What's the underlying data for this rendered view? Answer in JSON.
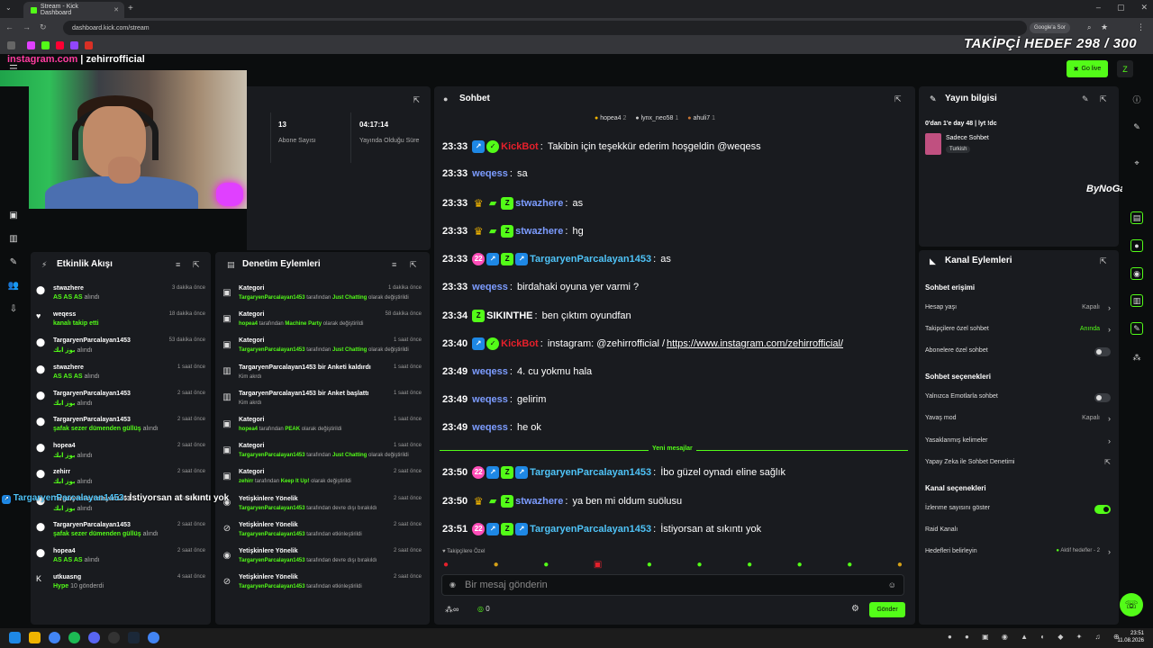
{
  "browser": {
    "tab_title": "Stream - Kick Dashboard",
    "url": "dashboard.kick.com/stream",
    "google_btn": "Google'a Sor"
  },
  "overlay": {
    "follower_goal": "TAKİPÇİ HEDEF 298 / 300",
    "instagram_site": "instagram.com",
    "instagram_user": "zehirrofficial",
    "bynogame": "ByNoGame"
  },
  "header": {
    "go_live": "Go live"
  },
  "stats": {
    "subscribers_value": "13",
    "subscribers_label": "Abone Sayısı",
    "duration_value": "04:17:14",
    "duration_label": "Yayında Olduğu Süre"
  },
  "activity": {
    "title": "Etkinlik Akışı",
    "items": [
      {
        "name": "stwazhere",
        "sub": "AS AS AS",
        "subnote": "alındı",
        "time": "3 dakika önce",
        "icon": "gift-icon"
      },
      {
        "name": "weqess",
        "sub": "kanalı takip etti",
        "subnote": "",
        "time": "18 dakika önce",
        "icon": "heart-icon"
      },
      {
        "name": "TargaryenParcalayan1453",
        "sub": "بوز ابك",
        "subnote": "alındı",
        "time": "53 dakika önce",
        "icon": "gift-icon"
      },
      {
        "name": "stwazhere",
        "sub": "AS AS AS",
        "subnote": "alındı",
        "time": "1 saat önce",
        "icon": "gift-icon"
      },
      {
        "name": "TargaryenParcalayan1453",
        "sub": "بوز ابك",
        "subnote": "alındı",
        "time": "2 saat önce",
        "icon": "gift-icon"
      },
      {
        "name": "TargaryenParcalayan1453",
        "sub": "şafak sezer dümenden güllüş",
        "subnote": "alındı",
        "time": "2 saat önce",
        "icon": "gift-icon"
      },
      {
        "name": "hopea4",
        "sub": "بوز ابك",
        "subnote": "alındı",
        "time": "2 saat önce",
        "icon": "gift-icon"
      },
      {
        "name": "zehirr",
        "sub": "بوز ابك",
        "subnote": "alındı",
        "time": "2 saat önce",
        "icon": "gift-icon"
      },
      {
        "name": "TargaryenParcalayan1453",
        "sub": "بوز ابك",
        "subnote": "alındı",
        "time": "2 saat önce",
        "icon": "gift-icon"
      },
      {
        "name": "TargaryenParcalayan1453",
        "sub": "şafak sezer dümenden güllüş",
        "subnote": "alındı",
        "time": "2 saat önce",
        "icon": "gift-icon"
      },
      {
        "name": "hopea4",
        "sub": "AS AS AS",
        "subnote": "alındı",
        "time": "2 saat önce",
        "icon": "gift-icon"
      },
      {
        "name": "utkuasng",
        "sub": "Hype",
        "subnote": "10 gönderdi",
        "time": "4 saat önce",
        "icon": "kick-icon"
      }
    ]
  },
  "moderation": {
    "title": "Denetim Eylemleri",
    "items": [
      {
        "title": "Kategori",
        "user": "TargaryenParcalayan1453",
        "mid": "tarafından",
        "target": "Just Chatting",
        "end": "olarak değiştirildi",
        "time": "1 dakika önce"
      },
      {
        "title": "Kategori",
        "user": "hopea4",
        "mid": "tarafından",
        "target": "Machine Party",
        "end": "olarak değiştirildi",
        "time": "58 dakika önce"
      },
      {
        "title": "Kategori",
        "user": "TargaryenParcalayan1453",
        "mid": "tarafından",
        "target": "Just Chatting",
        "end": "olarak değiştirildi",
        "time": "1 saat önce"
      },
      {
        "title": "TargaryenParcalayan1453 bir Anketi kaldırdı",
        "user": "",
        "mid": "Kim akrdı",
        "target": "",
        "end": "",
        "time": "1 saat önce"
      },
      {
        "title": "TargaryenParcalayan1453 bir Anket başlattı",
        "user": "",
        "mid": "Kim akrdı",
        "target": "",
        "end": "",
        "time": "1 saat önce"
      },
      {
        "title": "Kategori",
        "user": "hopea4",
        "mid": "tarafından",
        "target": "PEAK",
        "end": "olarak değiştirildi",
        "time": "1 saat önce"
      },
      {
        "title": "Kategori",
        "user": "TargaryenParcalayan1453",
        "mid": "tarafından",
        "target": "Just Chatting",
        "end": "olarak değiştirildi",
        "time": "1 saat önce"
      },
      {
        "title": "Kategori",
        "user": "zehirr",
        "mid": "tarafından",
        "target": "Keep It Up!",
        "end": "olarak değiştirildi",
        "time": "2 saat önce"
      },
      {
        "title": "Yetişkinlere Yönelik",
        "user": "TargaryenParcalayan1453",
        "mid": "tarafından devre dışı bırakıldı",
        "target": "",
        "end": "",
        "time": "2 saat önce"
      },
      {
        "title": "Yetişkinlere Yönelik",
        "user": "TargaryenParcalayan1453",
        "mid": "tarafından etkinleştirildi",
        "target": "",
        "end": "",
        "time": "2 saat önce"
      },
      {
        "title": "Yetişkinlere Yönelik",
        "user": "TargaryenParcalayan1453",
        "mid": "tarafından devre dışı bırakıldı",
        "target": "",
        "end": "",
        "time": "2 saat önce"
      },
      {
        "title": "Yetişkinlere Yönelik",
        "user": "TargaryenParcalayan1453",
        "mid": "tarafından etkinleştirildi",
        "target": "",
        "end": "",
        "time": "2 saat önce"
      }
    ]
  },
  "chat": {
    "title": "Sohbet",
    "top_gifters": [
      {
        "name": "hopea4",
        "count": "2"
      },
      {
        "name": "lynx_neo58",
        "count": "1"
      },
      {
        "name": "ahuli7",
        "count": "1"
      }
    ],
    "messages": [
      {
        "time": "23:33",
        "badges": [
          "blue",
          "check"
        ],
        "user": "KickBot",
        "ucls": "u-red",
        "text": "Takibin için teşekkür ederim hoşgeldin @weqess"
      },
      {
        "time": "23:33",
        "badges": [],
        "user": "weqess",
        "ucls": "u-lblue",
        "text": "sa"
      },
      {
        "time": "23:33",
        "badges": [
          "crown",
          "gift",
          "green"
        ],
        "user": "stwazhere",
        "ucls": "u-lblue",
        "text": "as"
      },
      {
        "time": "23:33",
        "badges": [
          "crown",
          "gift",
          "green"
        ],
        "user": "stwazhere",
        "ucls": "u-lblue",
        "text": "hg"
      },
      {
        "time": "23:33",
        "badges": [
          "pink",
          "blue",
          "green",
          "blue"
        ],
        "user": "TargaryenParcalayan1453",
        "ucls": "u-blue",
        "text": "as"
      },
      {
        "time": "23:33",
        "badges": [],
        "user": "weqess",
        "ucls": "u-lblue",
        "text": "birdahaki oyuna yer varmi ?"
      },
      {
        "time": "23:34",
        "badges": [
          "green"
        ],
        "user": "SIKINTHE",
        "ucls": "u-white",
        "text": "ben çıktım oyundfan"
      },
      {
        "time": "23:40",
        "badges": [
          "blue",
          "check"
        ],
        "user": "KickBot",
        "ucls": "u-red",
        "text": "instagram: @zehirrofficial / ",
        "link": "https://www.instagram.com/zehirrofficial/"
      },
      {
        "time": "23:49",
        "badges": [],
        "user": "weqess",
        "ucls": "u-lblue",
        "text": "4. cu yokmu hala"
      },
      {
        "time": "23:49",
        "badges": [],
        "user": "weqess",
        "ucls": "u-lblue",
        "text": "gelirim"
      },
      {
        "time": "23:49",
        "badges": [],
        "user": "weqess",
        "ucls": "u-lblue",
        "text": "he ok"
      },
      {
        "time": "23:50",
        "badges": [
          "pink",
          "blue",
          "green",
          "blue"
        ],
        "user": "TargaryenParcalayan1453",
        "ucls": "u-blue",
        "text": "İbo güzel oynadı eline sağlık"
      },
      {
        "time": "23:50",
        "badges": [
          "crown",
          "gift",
          "green"
        ],
        "user": "stwazhere",
        "ucls": "u-lblue",
        "text": "ya ben mi oldum suölusu"
      },
      {
        "time": "23:51",
        "badges": [
          "pink",
          "blue",
          "green",
          "blue"
        ],
        "user": "TargaryenParcalayan1453",
        "ucls": "u-blue",
        "text": "İstiyorsan at sıkıntı yok"
      }
    ],
    "new_messages_label": "Yeni mesajlar",
    "followers_only": "Takipçilere Özel",
    "input_placeholder": "Bir mesaj gönderin",
    "points": "0",
    "send": "Gönder",
    "overlay_msg_user": "TargaryenParcalayan1453",
    "overlay_msg_text": ": İstiyorsan at sıkıntı yok"
  },
  "stream_info": {
    "title": "Yayın bilgisi",
    "stream_title": "0'dan 1'e day 48 | lyt !dc",
    "category": "Sadece Sohbet",
    "language": "Turkish"
  },
  "channel_actions": {
    "title": "Kanal Eylemleri",
    "chat_access": "Sohbet erişimi",
    "account_age": "Hesap yaşı",
    "account_age_val": "Kapalı",
    "followers_chat": "Takipçilere özel sohbet",
    "followers_chat_val": "Anında",
    "subs_chat": "Abonelere özel sohbet",
    "chat_options": "Sohbet seçenekleri",
    "emotes_only": "Yalnızca Emotlarla sohbet",
    "slow_mode": "Yavaş mod",
    "slow_mode_val": "Kapalı",
    "banned_words": "Yasaklanmış kelimeler",
    "ai_mod": "Yapay Zeka ile Sohbet Denetimi",
    "channel_options": "Kanal seçenekleri",
    "show_viewers": "İzlenme sayısını göster",
    "raid": "Raid Kanalı",
    "goals": "Hedefleri belirleyin",
    "goals_val": "Aktif hedefler - 2"
  },
  "taskbar": {
    "time": "23:51",
    "date": "11.08.2026"
  },
  "colors": {
    "accent": "#53fc18",
    "bg": "#0b0d0e",
    "panel": "#191b1f",
    "kickbot": "#e5202b"
  }
}
